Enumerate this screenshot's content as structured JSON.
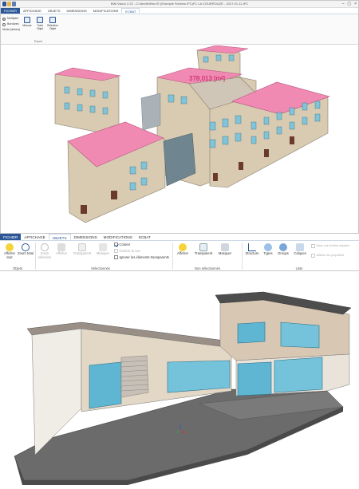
{
  "window1": {
    "title": "BIM Vision 2.22 - C:\\dev\\ifc\\Bim IE (Exemple Fichiers IFC)FC LA COURROUZE - 2017-01-11.IFC",
    "tabs": [
      "FICHIER",
      "AFFICHAGE",
      "OBJETS",
      "DIMENSIONS",
      "MODIFICATIONS",
      "ECBAT"
    ],
    "active_tab": "ECBAT",
    "mode": {
      "options": [
        "Multiples",
        "Bordures"
      ],
      "selected": "Multiples",
      "label": "Mode (dimen)"
    },
    "buttons": [
      {
        "label": "Mesure"
      },
      {
        "label": "Total Objet"
      },
      {
        "label": "Sélection Objet"
      }
    ],
    "group_label": "Export",
    "measurement": "378,013 [m²]"
  },
  "ribbon": {
    "tabs": [
      "FICHIER",
      "AFFICHAGE",
      "OBJETS",
      "DIMENSIONS",
      "MODIFICATIONS",
      "ECBAT"
    ],
    "active_tab": "OBJETS",
    "objets_group": {
      "label": "Objets",
      "buttons": [
        "Afficher tout",
        "Zoom total"
      ]
    },
    "selection_group": {
      "label": "Sélectionnés",
      "buttons": [
        "Zoom sélection",
        "Afficher",
        "Transparent",
        "Masquer"
      ],
      "checks": [
        {
          "label": "Colorer",
          "checked": true,
          "enabled": true
        },
        {
          "label": "Centrer la vue",
          "checked": false,
          "enabled": false
        },
        {
          "label": "Ignorer les éléments transparents",
          "checked": false,
          "enabled": true
        }
      ]
    },
    "non_selection_group": {
      "label": "Non sélectionnés",
      "buttons": [
        "Afficher",
        "Transparent",
        "Masquer"
      ]
    },
    "list_group": {
      "label": "Liste",
      "buttons": [
        "Structure",
        "Types",
        "Groups",
        "Calques"
      ],
      "checks": [
        {
          "label": "Dans une fenêtre séparée",
          "checked": false,
          "enabled": false
        },
        {
          "label": "Afficher les propriétés",
          "checked": false,
          "enabled": false
        }
      ]
    }
  },
  "colors": {
    "fichier_tab": "#2b5797",
    "roof_highlight": "#f08ab3",
    "wall": "#d9cbb2",
    "glass": "#7fc4d8"
  }
}
